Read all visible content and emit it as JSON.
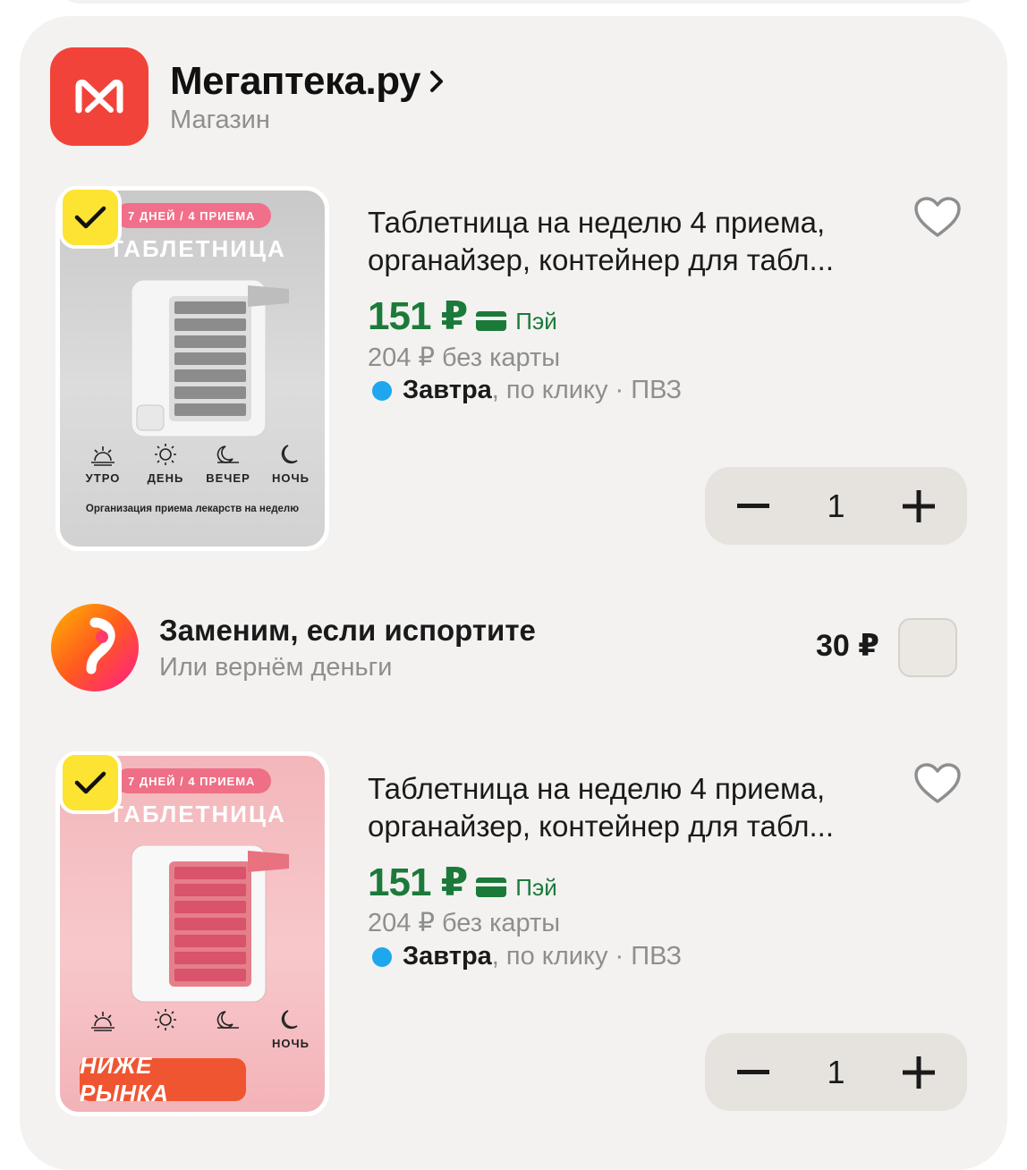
{
  "shop": {
    "name": "Мегаптека.ру",
    "type": "Магазин",
    "logo_icon": "megapteka-logo-icon",
    "brand_color": "#f2433b"
  },
  "products": [
    {
      "image_ribbon": "7 ДНЕЙ / 4 ПРИЕМА",
      "image_title": "ТАБЛЕТНИЦА",
      "image_days": [
        "УТРО",
        "ДЕНЬ",
        "ВЕЧЕР",
        "НОЧЬ"
      ],
      "image_caption": "Организация приема лекарств на неделю",
      "title": "Таблетница на неделю 4 приема, органайзер, контейнер для табл...",
      "price": "151 ₽",
      "pay_label": "Пэй",
      "old_price": "204 ₽ без карты",
      "delivery_day": "Завтра",
      "delivery_rest": ", по клику · ПВЗ",
      "quantity": "1",
      "selected": true
    },
    {
      "image_ribbon": "7 ДНЕЙ / 4 ПРИЕМА",
      "image_title": "ТАБЛЕТНИЦА",
      "image_days": [
        "",
        "",
        "",
        "НОЧЬ"
      ],
      "image_badge": "НИЖЕ РЫНКА",
      "title": "Таблетница на неделю 4 приема, органайзер, контейнер для табл...",
      "price": "151 ₽",
      "pay_label": "Пэй",
      "old_price": "204 ₽ без карты",
      "delivery_day": "Завтра",
      "delivery_rest": ", по клику · ПВЗ",
      "quantity": "1",
      "selected": true
    }
  ],
  "insurance": {
    "title": "Заменим, если испортите",
    "subtitle": "Или вернём деньги",
    "price": "30 ₽",
    "checked": false
  },
  "colors": {
    "price_green": "#1b7a3a",
    "delivery_dot": "#1ea7ee",
    "check_yellow": "#fde332",
    "badge_orange": "#f05532"
  }
}
